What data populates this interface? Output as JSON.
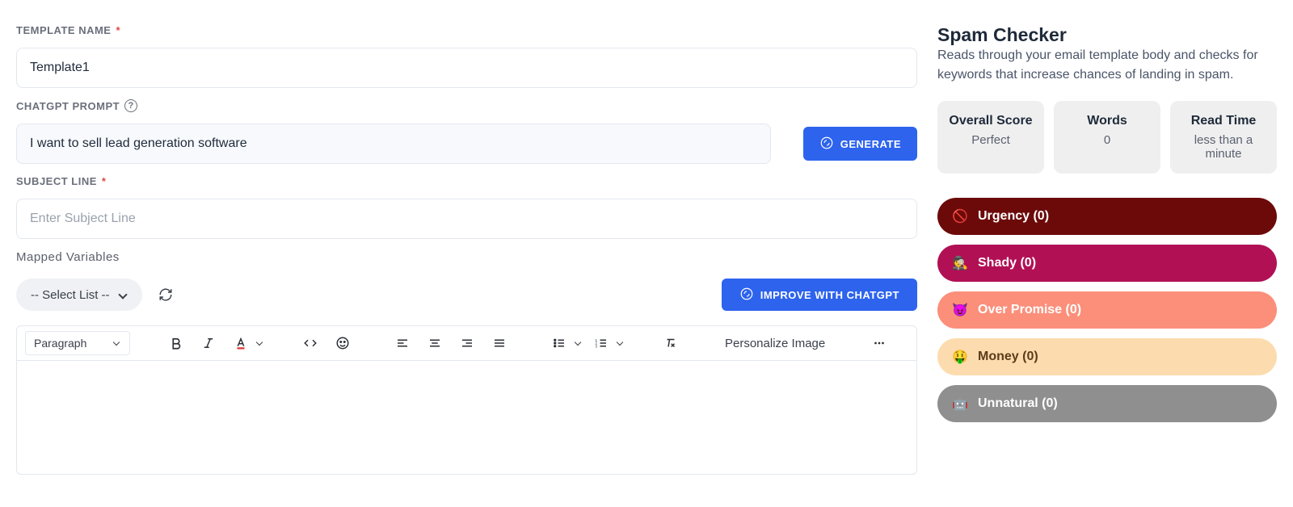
{
  "labels": {
    "template_name": "TEMPLATE NAME",
    "chatgpt_prompt": "CHATGPT PROMPT",
    "subject_line": "SUBJECT LINE",
    "mapped_vars": "Mapped Variables"
  },
  "template_name_value": "Template1",
  "chatgpt_prompt_value": "I want to sell lead generation software",
  "subject_line_placeholder": "Enter Subject Line",
  "mapped_select_label": "-- Select List --",
  "buttons": {
    "generate": "GENERATE",
    "improve": "IMPROVE WITH CHATGPT",
    "personalize": "Personalize Image"
  },
  "editor": {
    "block_format": "Paragraph"
  },
  "spam_checker": {
    "title": "Spam Checker",
    "description": "Reads through your email template body and checks for keywords that increase chances of landing in spam.",
    "metrics": [
      {
        "label": "Overall Score",
        "value": "Perfect"
      },
      {
        "label": "Words",
        "value": "0"
      },
      {
        "label": "Read Time",
        "value": "less than a minute"
      }
    ],
    "categories": [
      {
        "icon": "🚫",
        "label": "Urgency (0)",
        "color": "#6c0a0a"
      },
      {
        "icon": "🕵️",
        "label": "Shady (0)",
        "color": "#b11055"
      },
      {
        "icon": "😈",
        "label": "Over Promise (0)",
        "color": "#fb8f7a"
      },
      {
        "icon": "🤑",
        "label": "Money (0)",
        "color": "#fcdcae",
        "text": "#5a3c1a"
      },
      {
        "icon": "🤖",
        "label": "Unnatural (0)",
        "color": "#8f8f8f"
      }
    ]
  }
}
